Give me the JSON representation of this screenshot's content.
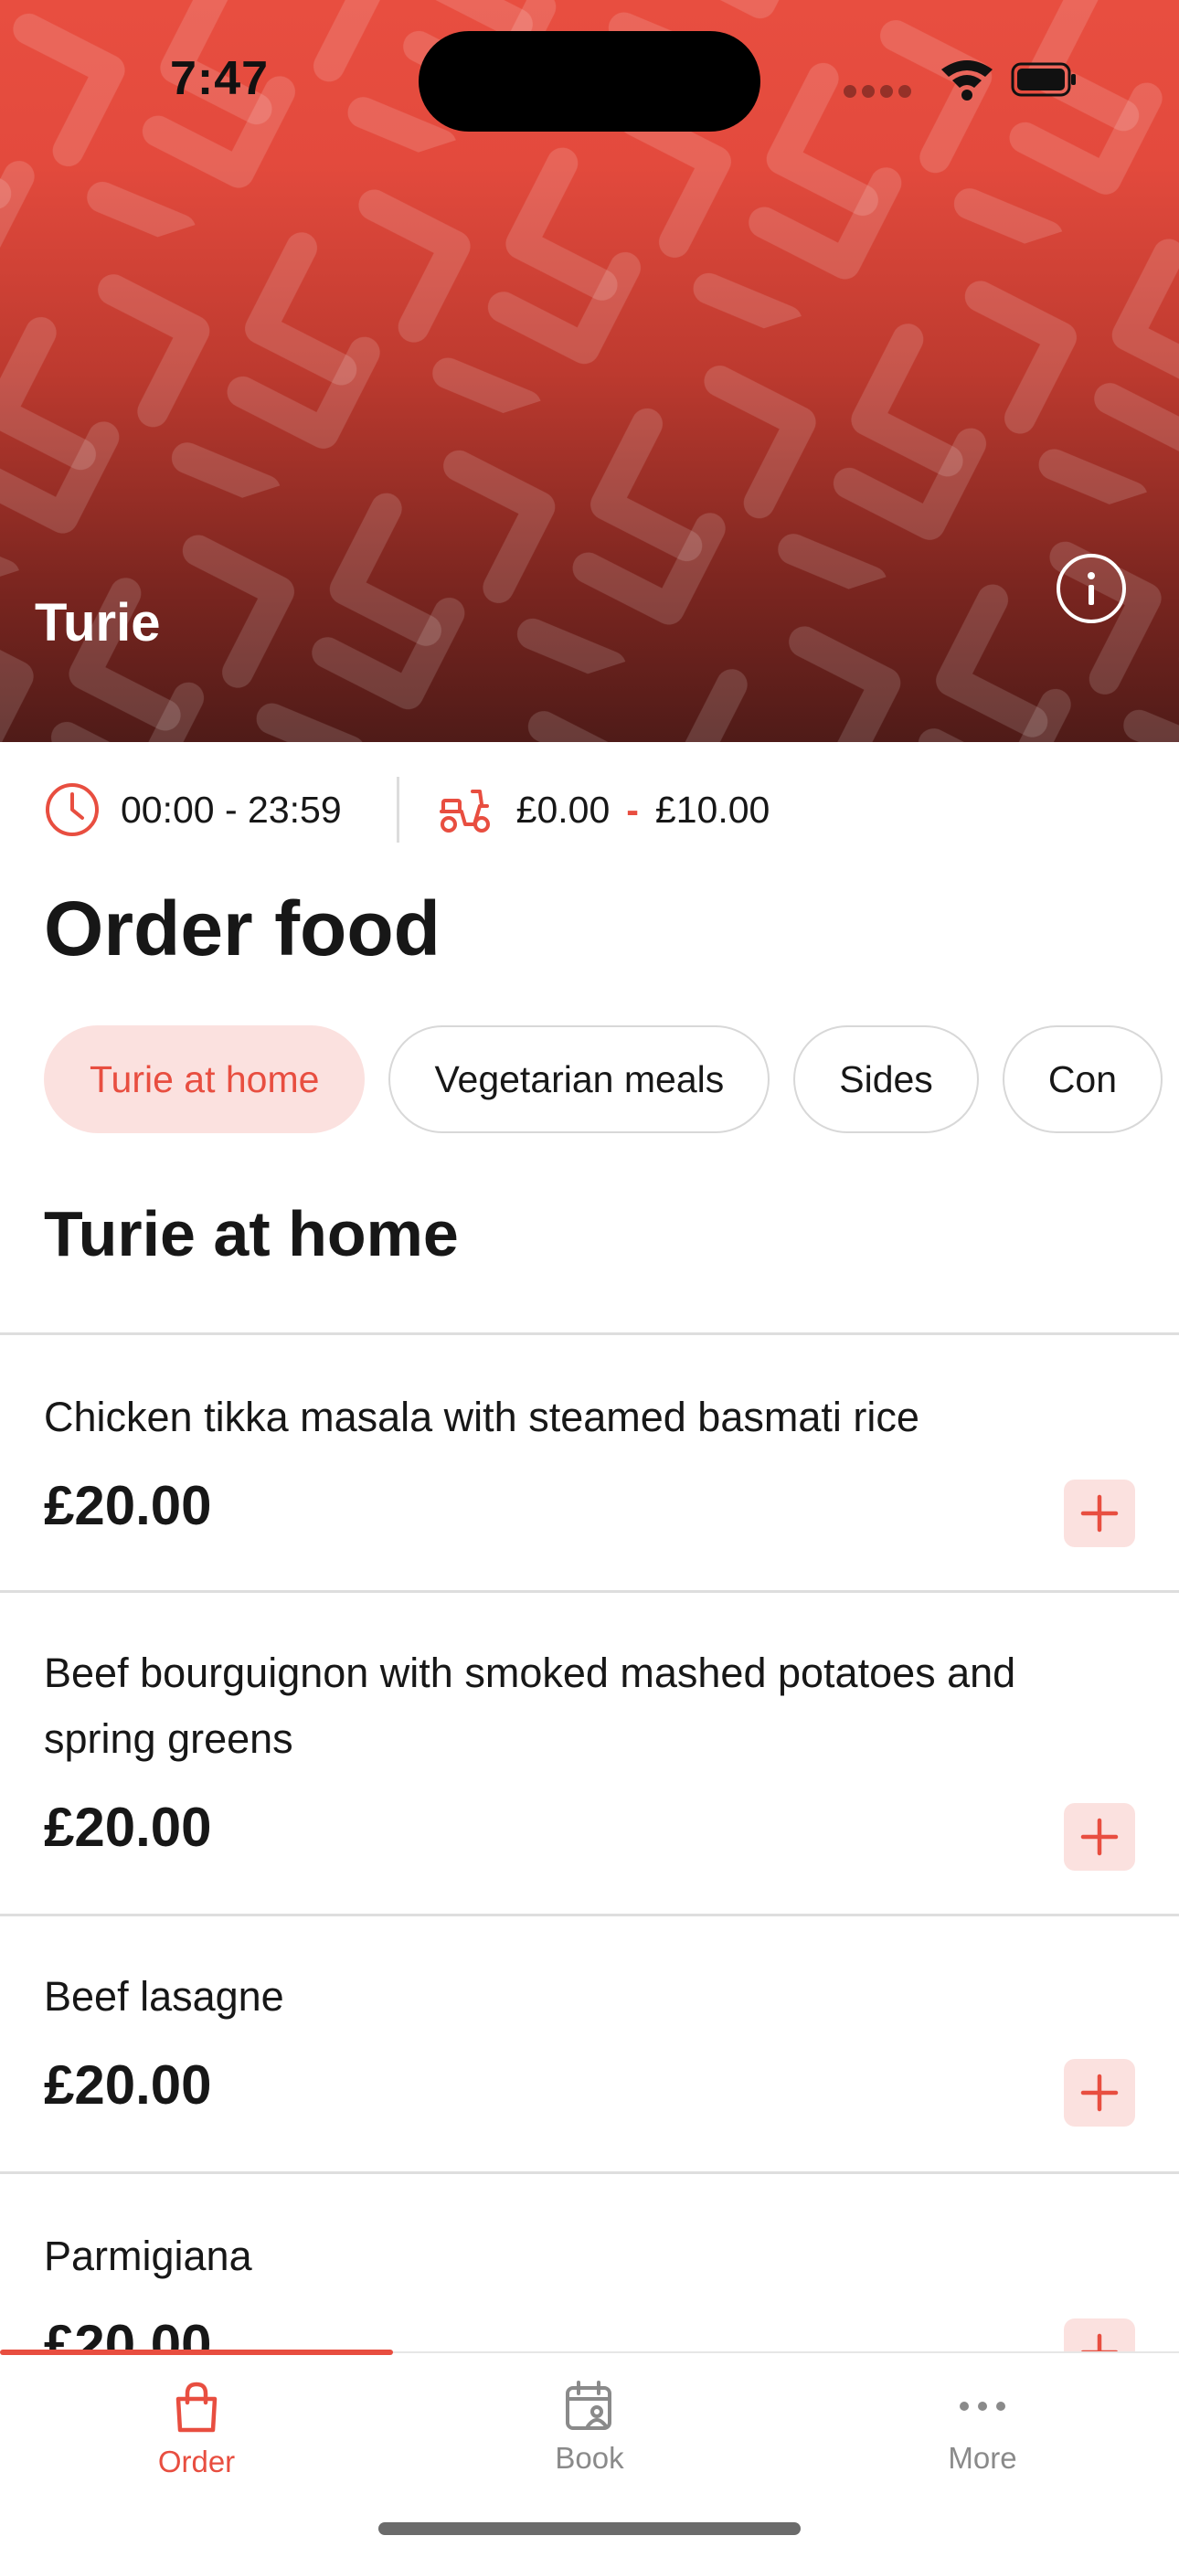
{
  "status_bar": {
    "time": "7:47"
  },
  "hero": {
    "restaurant_name": "Turie"
  },
  "info": {
    "hours": "00:00 - 23:59",
    "delivery_min": "£0.00",
    "delivery_separator": "-",
    "delivery_max": "£10.00"
  },
  "page_title": "Order food",
  "categories": [
    "Turie at home",
    "Vegetarian meals",
    "Sides",
    "Con"
  ],
  "section_title": "Turie at home",
  "menu": [
    {
      "name": "Chicken tikka masala with steamed basmati rice",
      "price": "£20.00"
    },
    {
      "name": "Beef bourguignon with smoked mashed potatoes and spring greens",
      "price": "£20.00"
    },
    {
      "name": "Beef  lasagne",
      "price": "£20.00"
    },
    {
      "name": "Parmigiana",
      "price": "£20.00"
    }
  ],
  "tabbar": {
    "tabs": [
      {
        "label": "Order",
        "icon": "bag-icon"
      },
      {
        "label": "Book",
        "icon": "calendar-person-icon"
      },
      {
        "label": "More",
        "icon": "more-dots-icon"
      }
    ]
  },
  "colors": {
    "accent": "#e84e40",
    "accent_soft": "#fbe1df",
    "text": "#171717",
    "muted": "#8a8a8a"
  }
}
